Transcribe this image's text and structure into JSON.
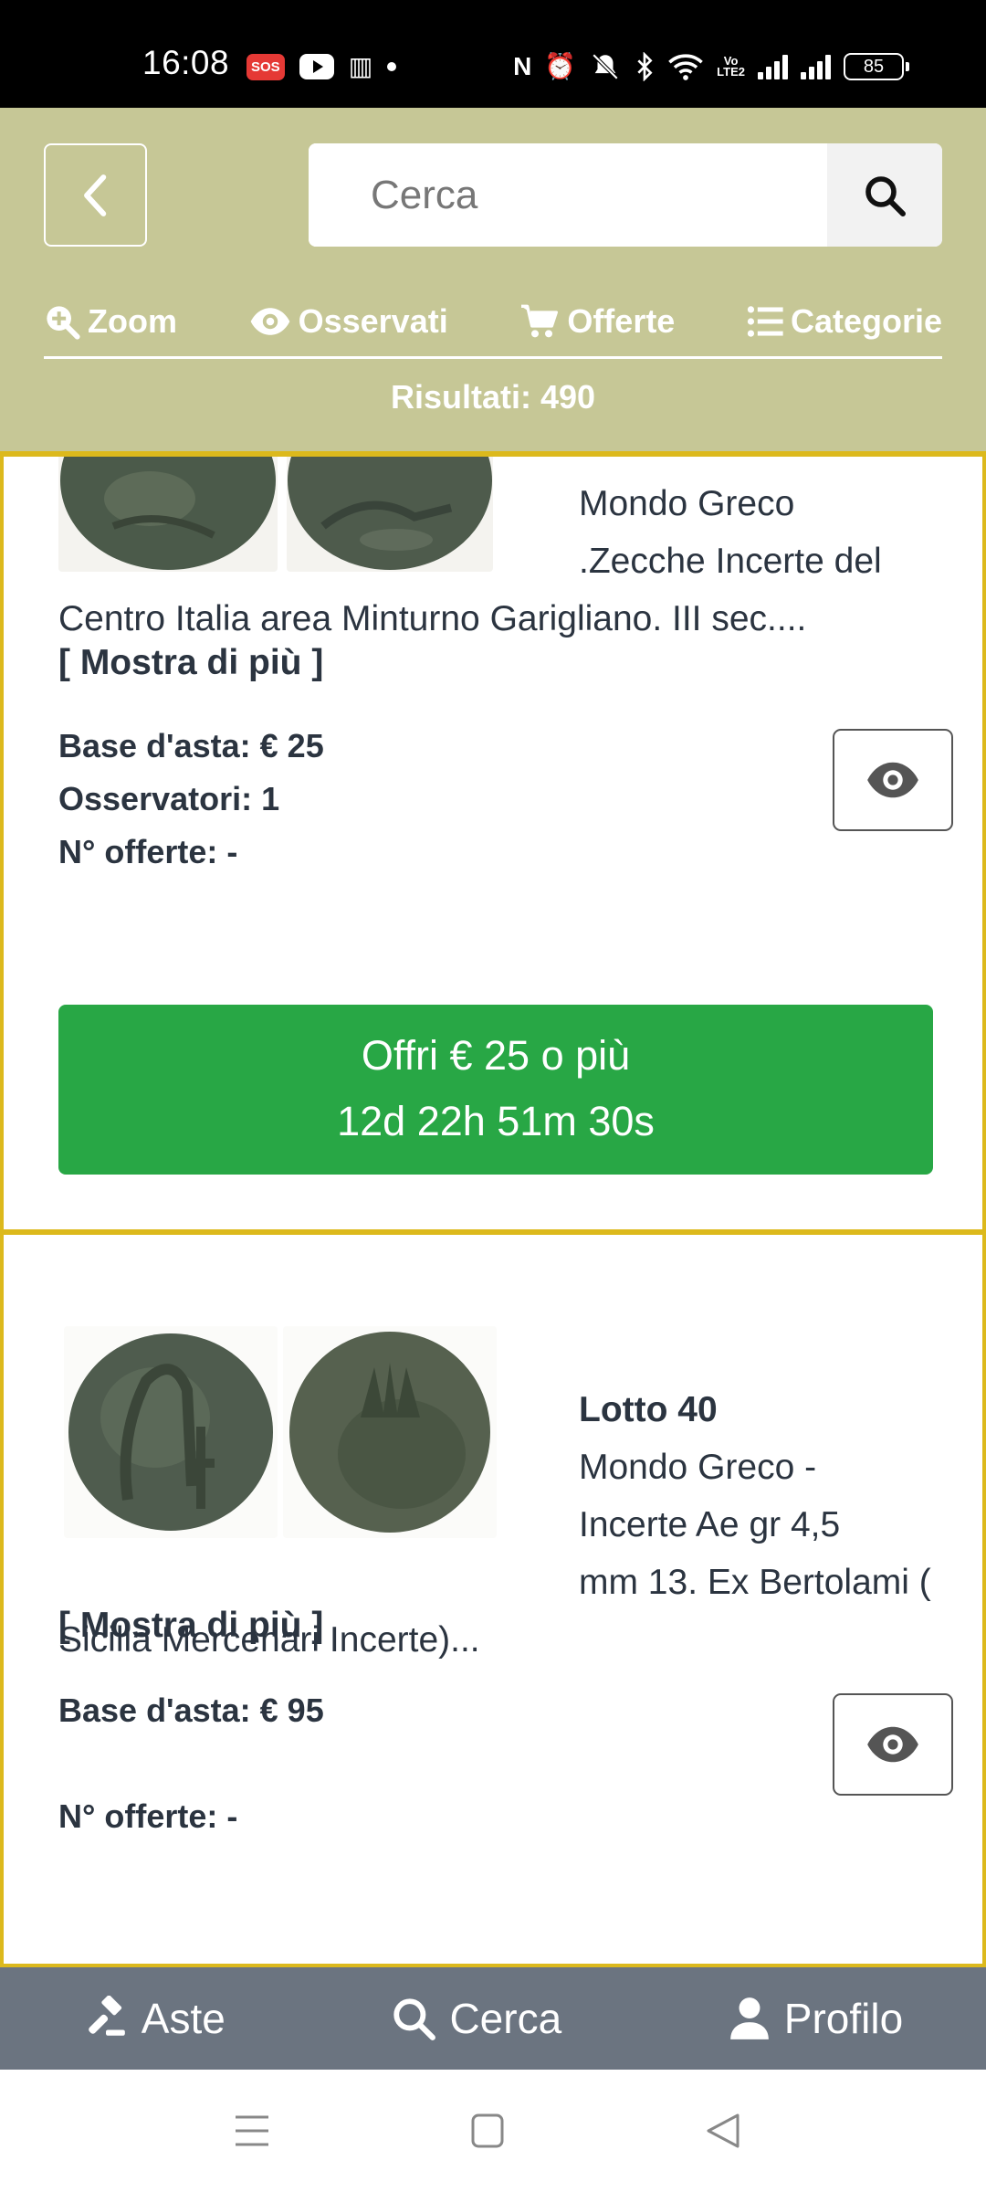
{
  "status_bar": {
    "time": "16:08",
    "sos": "SOS",
    "battery": "85",
    "volte_top": "Vo",
    "volte_bottom": "LTE2"
  },
  "header": {
    "search": {
      "placeholder": "Cerca"
    },
    "nav": [
      {
        "label": "Zoom",
        "icon": "zoom-in-icon"
      },
      {
        "label": "Osservati",
        "icon": "eye-icon"
      },
      {
        "label": "Offerte",
        "icon": "cart-icon"
      },
      {
        "label": "Categorie",
        "icon": "list-icon"
      }
    ],
    "results": "Risultati: 490"
  },
  "lots": [
    {
      "title": "",
      "desc_line1": "Mondo Greco",
      "desc_line2": ".Zecche Incerte del",
      "desc_rest": "Centro Italia area Minturno Garigliano. III sec....",
      "more": "[ Mostra di più ]",
      "base": "Base d'asta: € 25",
      "watchers": "Osservatori: 1",
      "offers": "N° offerte: -",
      "bid_line1": "Offri € 25 o più",
      "bid_line2": "12d 22h 51m 30s"
    },
    {
      "title": "Lotto 40",
      "desc_line1": "Mondo Greco -",
      "desc_line2": "Incerte Ae gr 4,5",
      "desc_rest": "mm 13. Ex Bertolami ( Sicilia Mercenari Incerte)...",
      "more": "[ Mostra di più ]",
      "base": "Base d'asta: € 95",
      "offers": "N° offerte: -"
    }
  ],
  "tabbar": [
    {
      "label": "Aste",
      "icon": "gavel-icon"
    },
    {
      "label": "Cerca",
      "icon": "search-icon"
    },
    {
      "label": "Profilo",
      "icon": "user-icon"
    }
  ],
  "colors": {
    "header_bg": "#c6c796",
    "card_border": "#dcb91c",
    "bid_button": "#28a745",
    "tabbar_bg": "#6b7480"
  }
}
